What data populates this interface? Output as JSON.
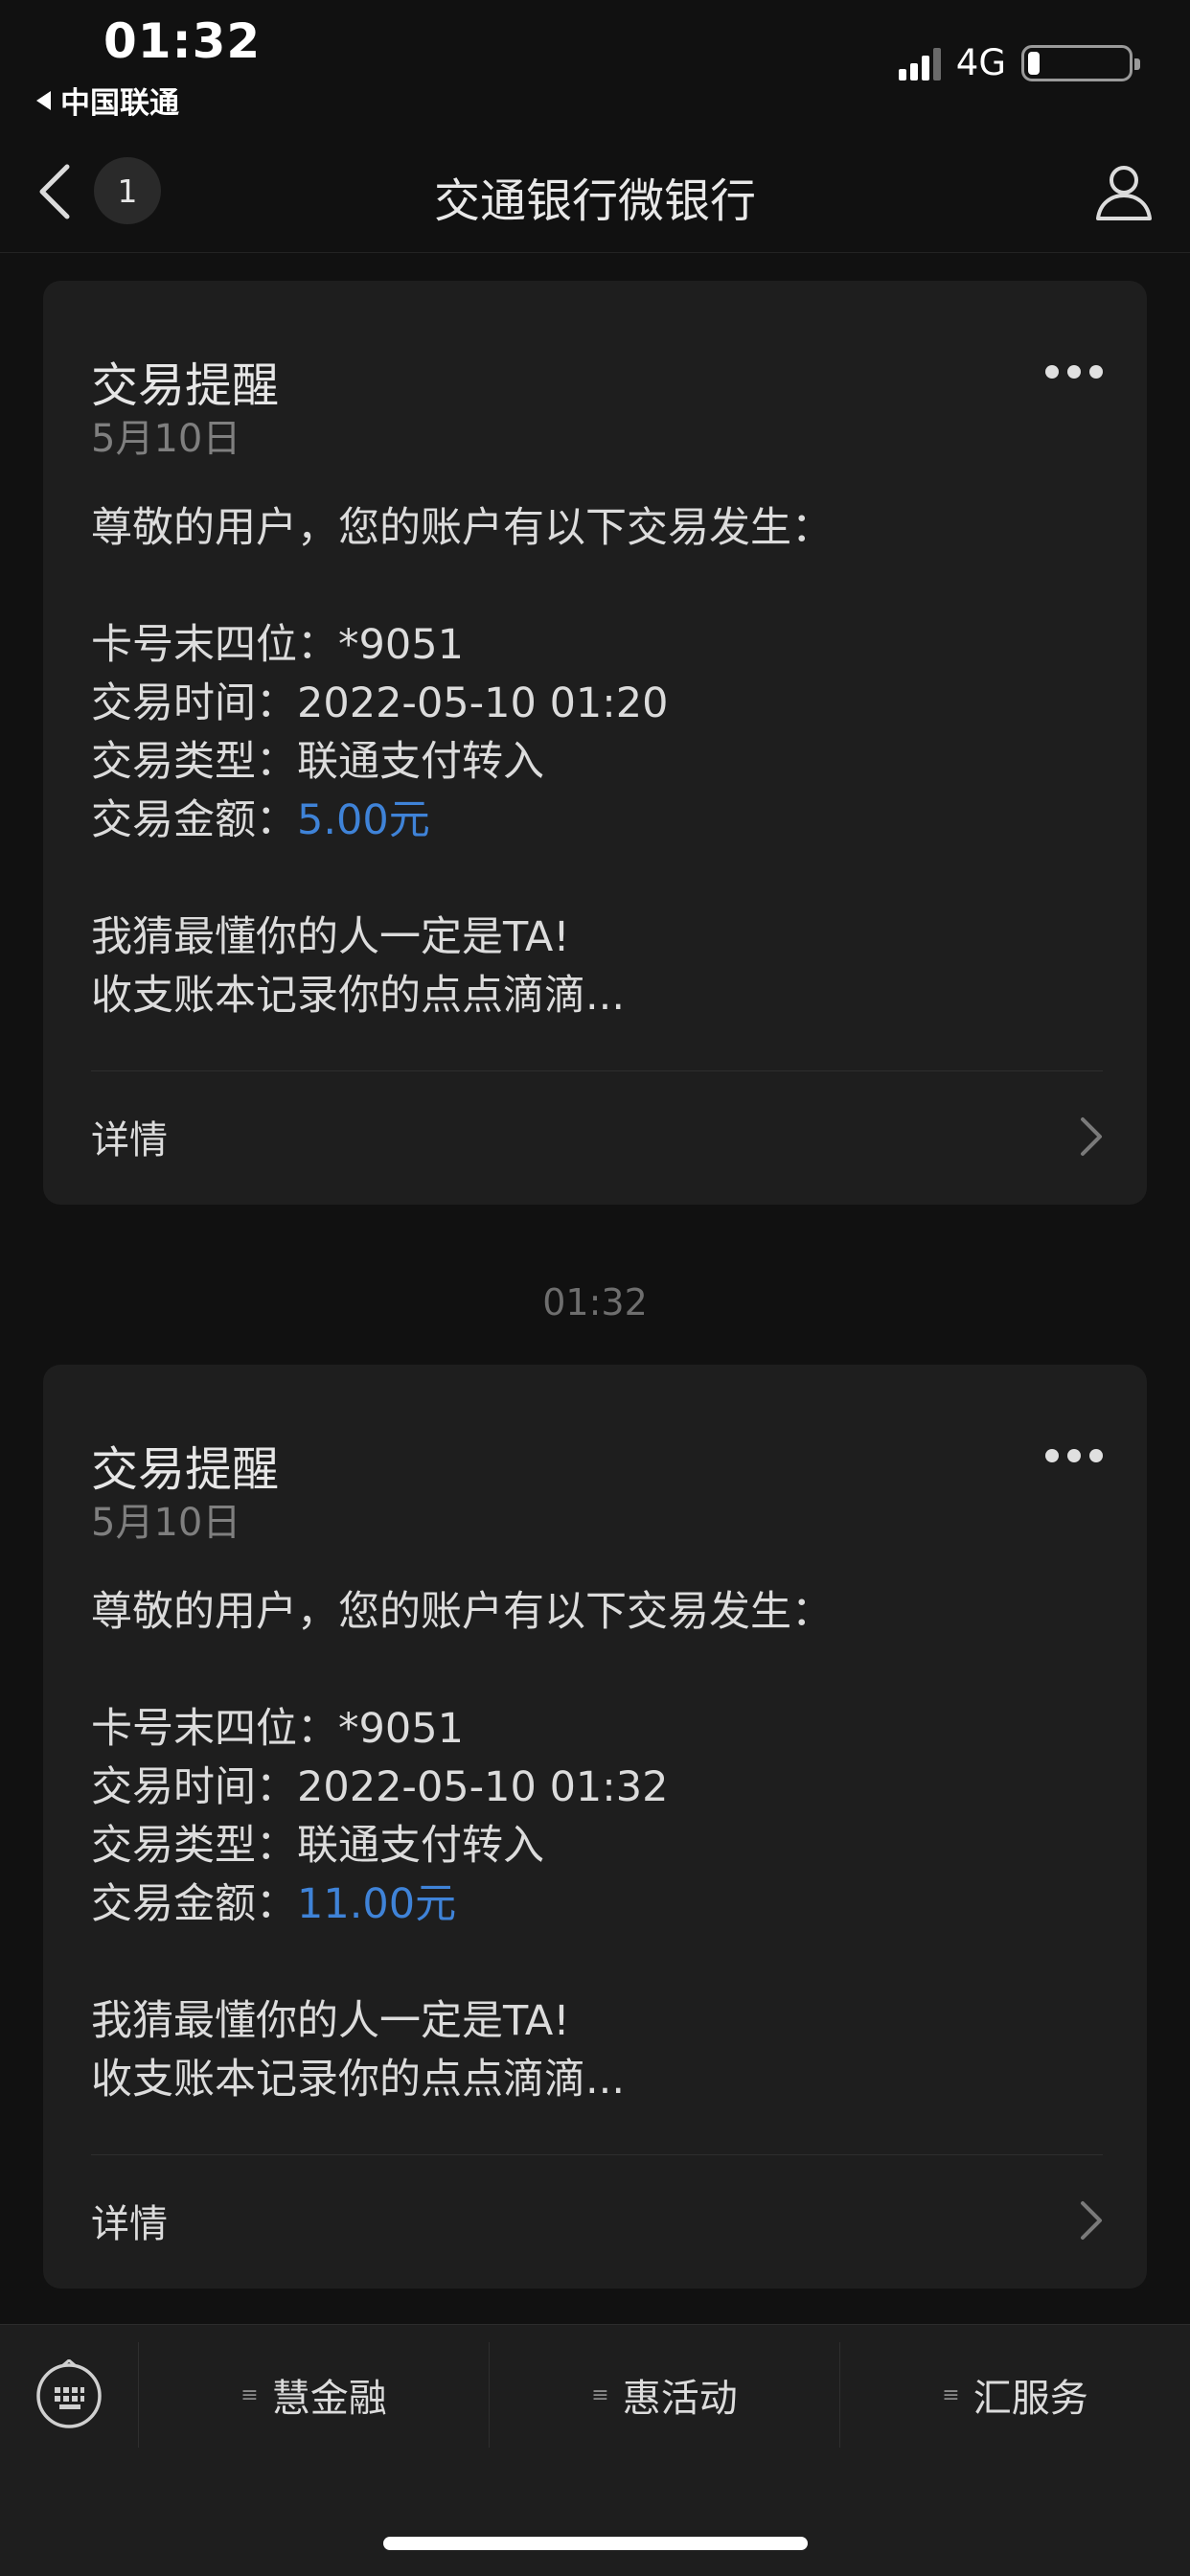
{
  "status_bar": {
    "time": "01:32",
    "carrier": "中国联通",
    "network": "4G"
  },
  "nav": {
    "unread_count": "1",
    "title": "交通银行微银行"
  },
  "messages": [
    {
      "title": "交易提醒",
      "date": "5月10日",
      "greeting": "尊敬的用户，您的账户有以下交易发生：",
      "card_label": "卡号末四位：",
      "card_value": "*9051",
      "time_label": "交易时间：",
      "time_value": "2022-05-10 01:20",
      "type_label": "交易类型：",
      "type_value": "联通支付转入",
      "amount_label": "交易金额：",
      "amount_value": "5.00元",
      "promo_line1": "我猜最懂你的人一定是TA!",
      "promo_line2": "收支账本记录你的点点滴滴...",
      "detail_label": "详情"
    },
    {
      "title": "交易提醒",
      "date": "5月10日",
      "greeting": "尊敬的用户，您的账户有以下交易发生：",
      "card_label": "卡号末四位：",
      "card_value": "*9051",
      "time_label": "交易时间：",
      "time_value": "2022-05-10 01:32",
      "type_label": "交易类型：",
      "type_value": "联通支付转入",
      "amount_label": "交易金额：",
      "amount_value": "11.00元",
      "promo_line1": "我猜最懂你的人一定是TA!",
      "promo_line2": "收支账本记录你的点点滴滴...",
      "detail_label": "详情"
    }
  ],
  "timestamp_divider": "01:32",
  "bottom_menu": {
    "items": [
      {
        "label": "慧金融"
      },
      {
        "label": "惠活动"
      },
      {
        "label": "汇服务"
      }
    ],
    "menu_glyph": "≡"
  },
  "colors": {
    "background": "#111111",
    "card": "#1e1e1e",
    "amount": "#3f83d8"
  },
  "icons": {
    "back": "chevron-left-icon",
    "profile": "person-icon",
    "more": "more-dots-icon",
    "detail": "chevron-right-icon",
    "keyboard": "keyboard-icon"
  }
}
